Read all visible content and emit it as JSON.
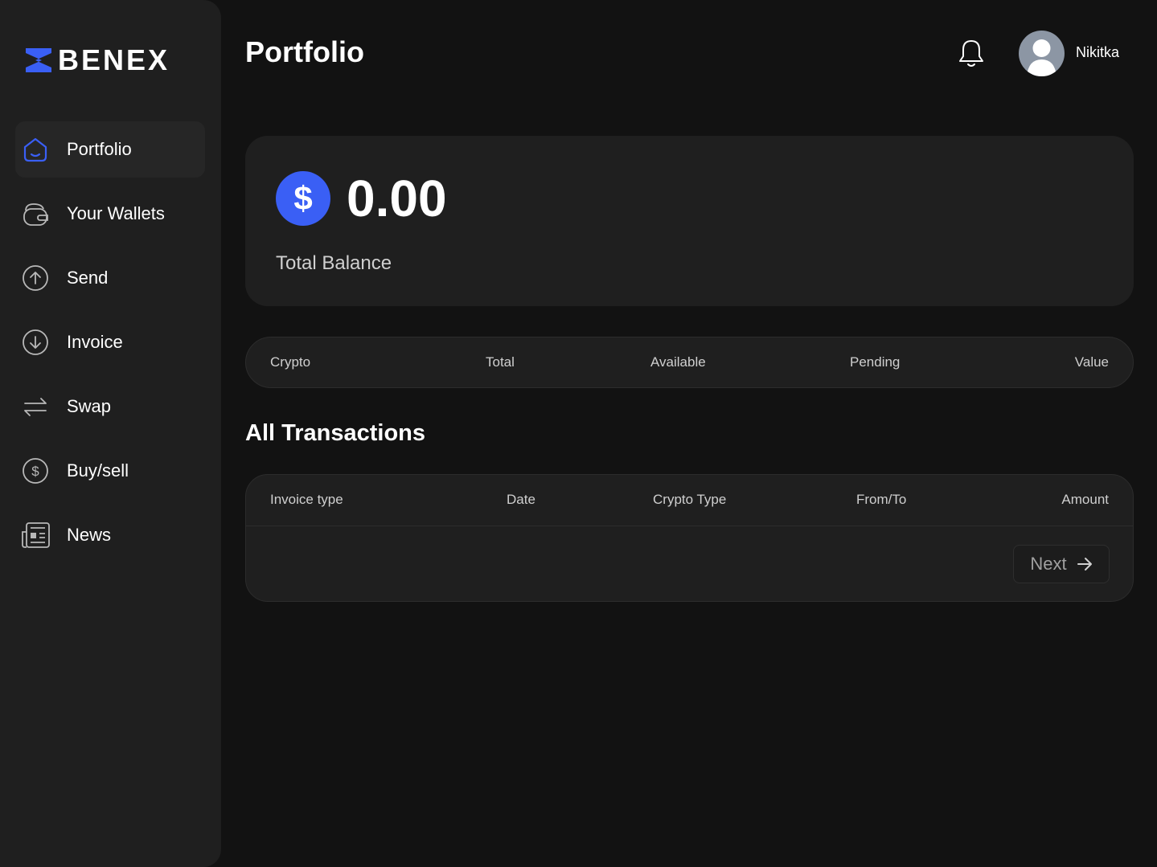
{
  "brand": {
    "name": "BENEX",
    "accent": "#3a5ff5"
  },
  "sidebar": {
    "items": [
      {
        "label": "Portfolio",
        "icon": "home-icon",
        "active": true
      },
      {
        "label": "Your Wallets",
        "icon": "wallet-icon",
        "active": false
      },
      {
        "label": "Send",
        "icon": "arrow-up-circle-icon",
        "active": false
      },
      {
        "label": "Invoice",
        "icon": "arrow-down-circle-icon",
        "active": false
      },
      {
        "label": "Swap",
        "icon": "swap-arrows-icon",
        "active": false
      },
      {
        "label": "Buy/sell",
        "icon": "dollar-circle-icon",
        "active": false
      },
      {
        "label": "News",
        "icon": "newspaper-icon",
        "active": false
      }
    ]
  },
  "header": {
    "title": "Portfolio",
    "user": {
      "name": "Nikitka"
    }
  },
  "balance": {
    "currency_symbol": "$",
    "value": "0.00",
    "label": "Total Balance"
  },
  "assets_table": {
    "columns": [
      "Crypto",
      "Total",
      "Available",
      "Pending",
      "Value"
    ]
  },
  "transactions": {
    "title": "All Transactions",
    "columns": [
      "Invoice type",
      "Date",
      "Crypto Type",
      "From/To",
      "Amount"
    ],
    "next_label": "Next"
  }
}
